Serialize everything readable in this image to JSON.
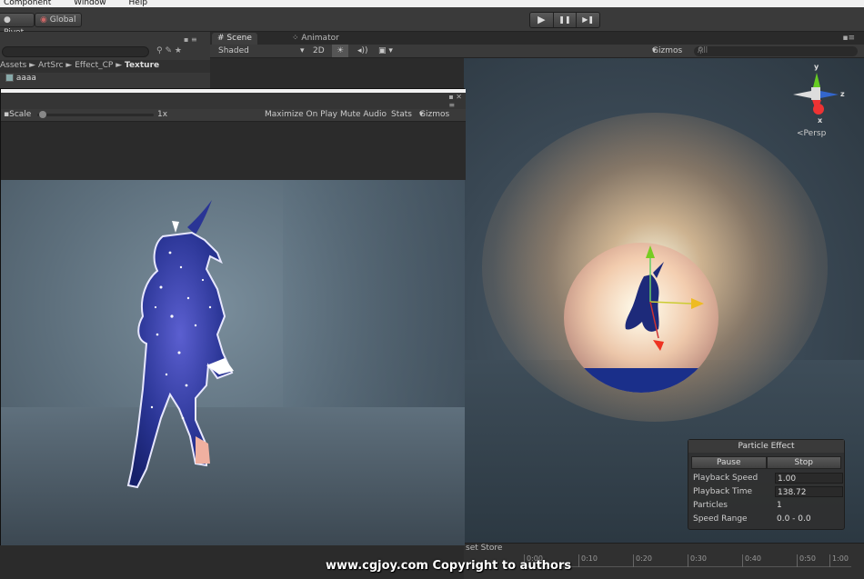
{
  "menu": {
    "items": [
      "Component",
      "Window",
      "Help"
    ]
  },
  "toolbar": {
    "pivot_label": "Pivot",
    "global_label": "Global",
    "play_icon": "▶",
    "pause_icon": "❚❚",
    "step_icon": "▶❚"
  },
  "project": {
    "breadcrumb": [
      "Assets",
      "ArtSrc",
      "Effect_CP",
      "Texture"
    ],
    "breadcrumb_sep": "►",
    "asset_item": "aaaa"
  },
  "scene": {
    "tabs": [
      {
        "label": "Scene",
        "icon": "#"
      },
      {
        "label": "Animator",
        "icon": "⁘"
      }
    ],
    "shading_mode": "Shaded",
    "mode_2d": "2D",
    "gizmos_label": "Gizmos",
    "search_placeholder": "All",
    "persp_label": "Persp",
    "axes": {
      "y": "y",
      "z": "z",
      "x": "x"
    }
  },
  "game": {
    "scale_label": "Scale",
    "scale_value": "1x",
    "maximize_on_play": "Maximize On Play",
    "mute_audio": "Mute Audio",
    "stats": "Stats",
    "gizmos": "Gizmos"
  },
  "particle_effect": {
    "title": "Particle Effect",
    "pause_label": "Pause",
    "stop_label": "Stop",
    "rows": [
      {
        "label": "Playback Speed",
        "value": "1.00"
      },
      {
        "label": "Playback Time",
        "value": "138.72"
      },
      {
        "label": "Particles",
        "value": "1"
      },
      {
        "label": "Speed Range",
        "value": "0.0 - 0.0"
      }
    ]
  },
  "timeline": {
    "label": "set Store",
    "ticks": [
      "0:00",
      "0:10",
      "0:20",
      "0:30",
      "0:40",
      "0:50",
      "1:00"
    ]
  },
  "watermark": "www.cgjoy.com Copyright to authors"
}
